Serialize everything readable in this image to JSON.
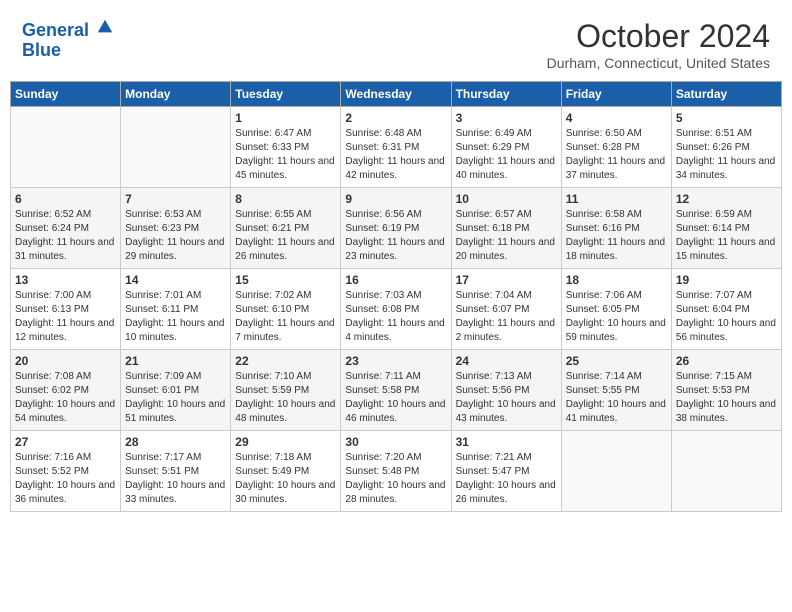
{
  "header": {
    "logo_line1": "General",
    "logo_line2": "Blue",
    "month": "October 2024",
    "location": "Durham, Connecticut, United States"
  },
  "days_of_week": [
    "Sunday",
    "Monday",
    "Tuesday",
    "Wednesday",
    "Thursday",
    "Friday",
    "Saturday"
  ],
  "weeks": [
    [
      {
        "day": "",
        "sunrise": "",
        "sunset": "",
        "daylight": "",
        "empty": true
      },
      {
        "day": "",
        "sunrise": "",
        "sunset": "",
        "daylight": "",
        "empty": true
      },
      {
        "day": "1",
        "sunrise": "Sunrise: 6:47 AM",
        "sunset": "Sunset: 6:33 PM",
        "daylight": "Daylight: 11 hours and 45 minutes.",
        "empty": false
      },
      {
        "day": "2",
        "sunrise": "Sunrise: 6:48 AM",
        "sunset": "Sunset: 6:31 PM",
        "daylight": "Daylight: 11 hours and 42 minutes.",
        "empty": false
      },
      {
        "day": "3",
        "sunrise": "Sunrise: 6:49 AM",
        "sunset": "Sunset: 6:29 PM",
        "daylight": "Daylight: 11 hours and 40 minutes.",
        "empty": false
      },
      {
        "day": "4",
        "sunrise": "Sunrise: 6:50 AM",
        "sunset": "Sunset: 6:28 PM",
        "daylight": "Daylight: 11 hours and 37 minutes.",
        "empty": false
      },
      {
        "day": "5",
        "sunrise": "Sunrise: 6:51 AM",
        "sunset": "Sunset: 6:26 PM",
        "daylight": "Daylight: 11 hours and 34 minutes.",
        "empty": false
      }
    ],
    [
      {
        "day": "6",
        "sunrise": "Sunrise: 6:52 AM",
        "sunset": "Sunset: 6:24 PM",
        "daylight": "Daylight: 11 hours and 31 minutes.",
        "empty": false
      },
      {
        "day": "7",
        "sunrise": "Sunrise: 6:53 AM",
        "sunset": "Sunset: 6:23 PM",
        "daylight": "Daylight: 11 hours and 29 minutes.",
        "empty": false
      },
      {
        "day": "8",
        "sunrise": "Sunrise: 6:55 AM",
        "sunset": "Sunset: 6:21 PM",
        "daylight": "Daylight: 11 hours and 26 minutes.",
        "empty": false
      },
      {
        "day": "9",
        "sunrise": "Sunrise: 6:56 AM",
        "sunset": "Sunset: 6:19 PM",
        "daylight": "Daylight: 11 hours and 23 minutes.",
        "empty": false
      },
      {
        "day": "10",
        "sunrise": "Sunrise: 6:57 AM",
        "sunset": "Sunset: 6:18 PM",
        "daylight": "Daylight: 11 hours and 20 minutes.",
        "empty": false
      },
      {
        "day": "11",
        "sunrise": "Sunrise: 6:58 AM",
        "sunset": "Sunset: 6:16 PM",
        "daylight": "Daylight: 11 hours and 18 minutes.",
        "empty": false
      },
      {
        "day": "12",
        "sunrise": "Sunrise: 6:59 AM",
        "sunset": "Sunset: 6:14 PM",
        "daylight": "Daylight: 11 hours and 15 minutes.",
        "empty": false
      }
    ],
    [
      {
        "day": "13",
        "sunrise": "Sunrise: 7:00 AM",
        "sunset": "Sunset: 6:13 PM",
        "daylight": "Daylight: 11 hours and 12 minutes.",
        "empty": false
      },
      {
        "day": "14",
        "sunrise": "Sunrise: 7:01 AM",
        "sunset": "Sunset: 6:11 PM",
        "daylight": "Daylight: 11 hours and 10 minutes.",
        "empty": false
      },
      {
        "day": "15",
        "sunrise": "Sunrise: 7:02 AM",
        "sunset": "Sunset: 6:10 PM",
        "daylight": "Daylight: 11 hours and 7 minutes.",
        "empty": false
      },
      {
        "day": "16",
        "sunrise": "Sunrise: 7:03 AM",
        "sunset": "Sunset: 6:08 PM",
        "daylight": "Daylight: 11 hours and 4 minutes.",
        "empty": false
      },
      {
        "day": "17",
        "sunrise": "Sunrise: 7:04 AM",
        "sunset": "Sunset: 6:07 PM",
        "daylight": "Daylight: 11 hours and 2 minutes.",
        "empty": false
      },
      {
        "day": "18",
        "sunrise": "Sunrise: 7:06 AM",
        "sunset": "Sunset: 6:05 PM",
        "daylight": "Daylight: 10 hours and 59 minutes.",
        "empty": false
      },
      {
        "day": "19",
        "sunrise": "Sunrise: 7:07 AM",
        "sunset": "Sunset: 6:04 PM",
        "daylight": "Daylight: 10 hours and 56 minutes.",
        "empty": false
      }
    ],
    [
      {
        "day": "20",
        "sunrise": "Sunrise: 7:08 AM",
        "sunset": "Sunset: 6:02 PM",
        "daylight": "Daylight: 10 hours and 54 minutes.",
        "empty": false
      },
      {
        "day": "21",
        "sunrise": "Sunrise: 7:09 AM",
        "sunset": "Sunset: 6:01 PM",
        "daylight": "Daylight: 10 hours and 51 minutes.",
        "empty": false
      },
      {
        "day": "22",
        "sunrise": "Sunrise: 7:10 AM",
        "sunset": "Sunset: 5:59 PM",
        "daylight": "Daylight: 10 hours and 48 minutes.",
        "empty": false
      },
      {
        "day": "23",
        "sunrise": "Sunrise: 7:11 AM",
        "sunset": "Sunset: 5:58 PM",
        "daylight": "Daylight: 10 hours and 46 minutes.",
        "empty": false
      },
      {
        "day": "24",
        "sunrise": "Sunrise: 7:13 AM",
        "sunset": "Sunset: 5:56 PM",
        "daylight": "Daylight: 10 hours and 43 minutes.",
        "empty": false
      },
      {
        "day": "25",
        "sunrise": "Sunrise: 7:14 AM",
        "sunset": "Sunset: 5:55 PM",
        "daylight": "Daylight: 10 hours and 41 minutes.",
        "empty": false
      },
      {
        "day": "26",
        "sunrise": "Sunrise: 7:15 AM",
        "sunset": "Sunset: 5:53 PM",
        "daylight": "Daylight: 10 hours and 38 minutes.",
        "empty": false
      }
    ],
    [
      {
        "day": "27",
        "sunrise": "Sunrise: 7:16 AM",
        "sunset": "Sunset: 5:52 PM",
        "daylight": "Daylight: 10 hours and 36 minutes.",
        "empty": false
      },
      {
        "day": "28",
        "sunrise": "Sunrise: 7:17 AM",
        "sunset": "Sunset: 5:51 PM",
        "daylight": "Daylight: 10 hours and 33 minutes.",
        "empty": false
      },
      {
        "day": "29",
        "sunrise": "Sunrise: 7:18 AM",
        "sunset": "Sunset: 5:49 PM",
        "daylight": "Daylight: 10 hours and 30 minutes.",
        "empty": false
      },
      {
        "day": "30",
        "sunrise": "Sunrise: 7:20 AM",
        "sunset": "Sunset: 5:48 PM",
        "daylight": "Daylight: 10 hours and 28 minutes.",
        "empty": false
      },
      {
        "day": "31",
        "sunrise": "Sunrise: 7:21 AM",
        "sunset": "Sunset: 5:47 PM",
        "daylight": "Daylight: 10 hours and 26 minutes.",
        "empty": false
      },
      {
        "day": "",
        "sunrise": "",
        "sunset": "",
        "daylight": "",
        "empty": true
      },
      {
        "day": "",
        "sunrise": "",
        "sunset": "",
        "daylight": "",
        "empty": true
      }
    ]
  ]
}
